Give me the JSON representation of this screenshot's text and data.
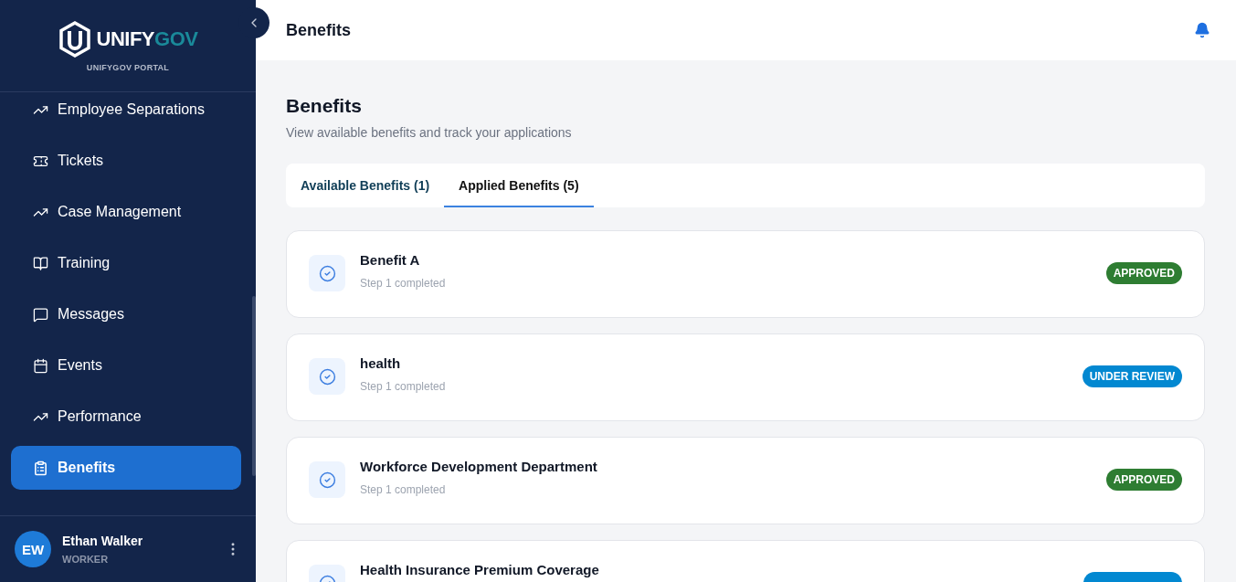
{
  "brand": {
    "name_start": "UNIFY",
    "name_end": "GOV",
    "subtitle": "UNIFYGOV PORTAL"
  },
  "nav": [
    {
      "label": "Employee Separations",
      "kind": "trend",
      "selected": false
    },
    {
      "label": "Tickets",
      "kind": "ticket",
      "selected": false
    },
    {
      "label": "Case Management",
      "kind": "trend",
      "selected": false
    },
    {
      "label": "Training",
      "kind": "book",
      "selected": false
    },
    {
      "label": "Messages",
      "kind": "message",
      "selected": false
    },
    {
      "label": "Events",
      "kind": "calendar",
      "selected": false
    },
    {
      "label": "Performance",
      "kind": "trend",
      "selected": false
    },
    {
      "label": "Benefits",
      "kind": "clipboard",
      "selected": true
    }
  ],
  "user": {
    "initials": "EW",
    "name": "Ethan Walker",
    "role": "WORKER"
  },
  "header": {
    "title": "Benefits"
  },
  "page": {
    "title": "Benefits",
    "subtitle": "View available benefits and track your applications"
  },
  "tabs": [
    {
      "label": "Available Benefits (1)",
      "selected": false
    },
    {
      "label": "Applied Benefits (5)",
      "selected": true
    }
  ],
  "benefits": [
    {
      "name": "Benefit A",
      "step": "Step 1 completed",
      "status": "APPROVED",
      "color": "#2e7d32"
    },
    {
      "name": "health",
      "step": "Step 1 completed",
      "status": "UNDER REVIEW",
      "color": "#0288d1"
    },
    {
      "name": "Workforce Development Department",
      "step": "Step 1 completed",
      "status": "APPROVED",
      "color": "#2e7d32"
    },
    {
      "name": "Health Insurance Premium Coverage",
      "color": "#0288d1"
    }
  ]
}
